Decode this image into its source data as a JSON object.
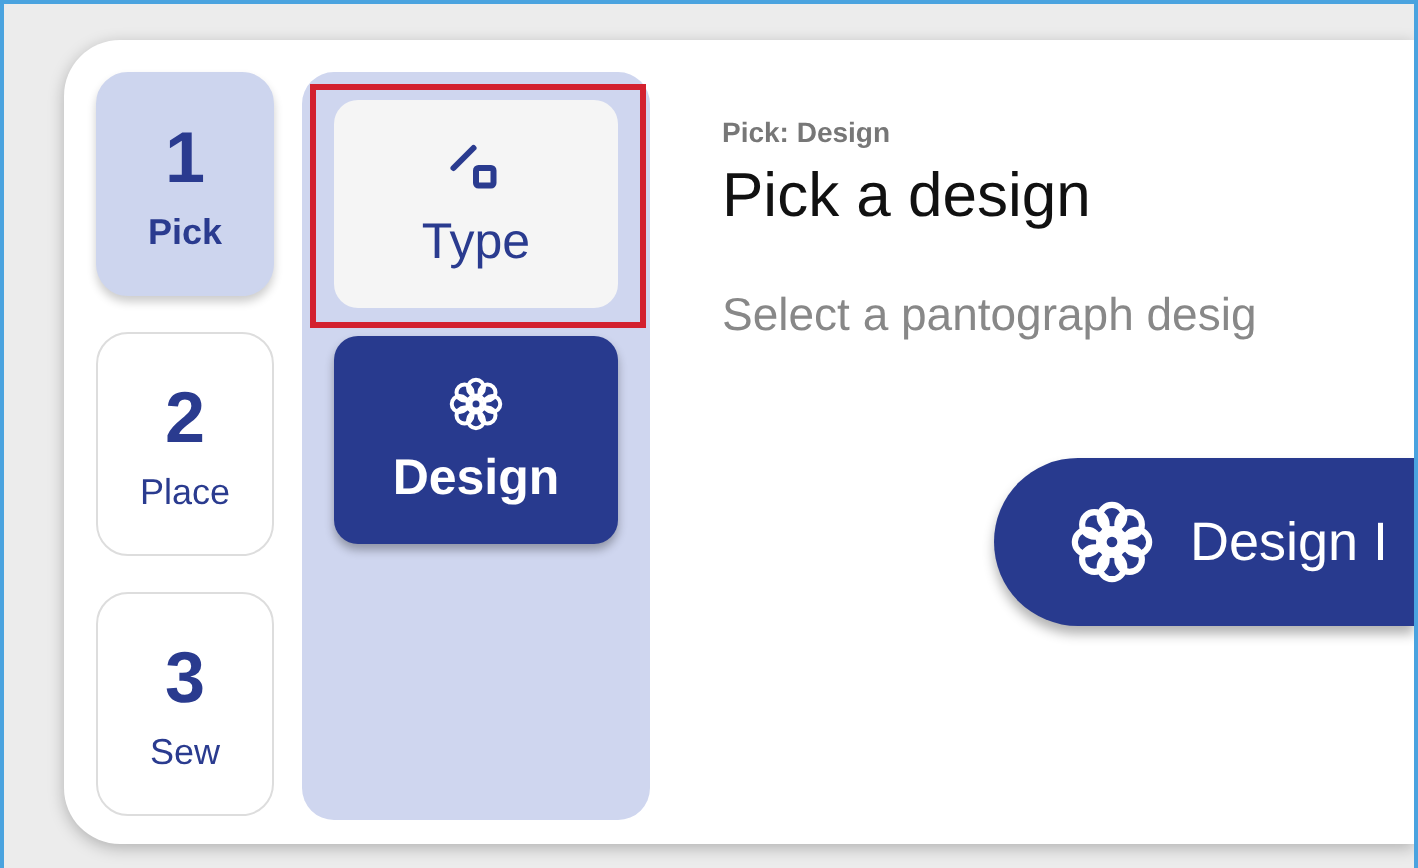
{
  "steps": [
    {
      "number": "1",
      "label": "Pick",
      "selected": true
    },
    {
      "number": "2",
      "label": "Place",
      "selected": false
    },
    {
      "number": "3",
      "label": "Sew",
      "selected": false
    }
  ],
  "options": [
    {
      "kind": "shape",
      "label": "Type",
      "selected": false,
      "highlighted": true
    },
    {
      "kind": "flower",
      "label": "Design",
      "selected": true,
      "highlighted": false
    }
  ],
  "content": {
    "breadcrumb": "Pick: Design",
    "heading": "Pick a design",
    "subtitle": "Select a pantograph desig",
    "action": {
      "kind": "flower",
      "label": "Design I"
    }
  }
}
